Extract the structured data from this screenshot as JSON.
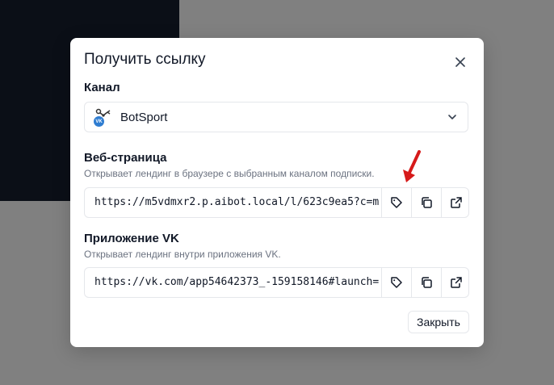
{
  "dialog": {
    "title": "Получить ссылку",
    "close_icon": "close-icon"
  },
  "channel": {
    "label": "Канал",
    "selected": "BotSport",
    "avatar_badge": "VK",
    "icon": "chevron-down-icon"
  },
  "web": {
    "label": "Веб-страница",
    "description": "Открывает лендинг в браузере с выбранным каналом подписки.",
    "url": "https://m5vdmxr2.p.aibot.local/l/623c9ea5?c=m",
    "buttons": [
      "tag-icon",
      "copy-icon",
      "external-link-icon"
    ]
  },
  "vk": {
    "label": "Приложение VK",
    "description": "Открывает лендинг внутри приложения VK.",
    "url": "https://vk.com/app54642373_-159158146#launch=",
    "buttons": [
      "tag-icon",
      "copy-icon",
      "external-link-icon"
    ]
  },
  "footer": {
    "close_label": "Закрыть"
  },
  "colors": {
    "backdrop": "#808080",
    "dark_panel": "#0b0f17",
    "annotation_arrow": "#d61a1a",
    "vk_blue": "#2f7dd1"
  }
}
